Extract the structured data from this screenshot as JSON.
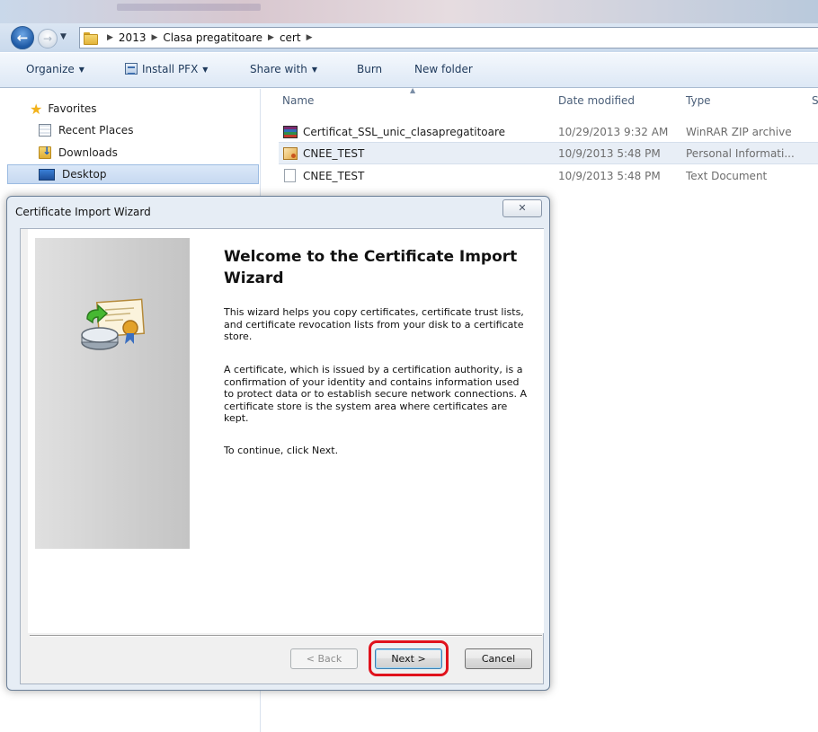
{
  "explorer": {
    "breadcrumbs": [
      "2013",
      "Clasa pregatitoare",
      "cert"
    ],
    "toolbar": {
      "organize": "Organize",
      "install_pfx": "Install PFX",
      "share_with": "Share with",
      "burn": "Burn",
      "new_folder": "New folder"
    },
    "nav": {
      "favorites": "Favorites",
      "recent_places": "Recent Places",
      "downloads": "Downloads",
      "desktop": "Desktop"
    },
    "columns": {
      "name": "Name",
      "date_modified": "Date modified",
      "type": "Type",
      "size": "S"
    },
    "files": [
      {
        "name": "Certificat_SSL_unic_clasapregatitoare",
        "date": "10/29/2013 9:32 AM",
        "type": "WinRAR ZIP archive",
        "icon": "winrar-archive-icon"
      },
      {
        "name": "CNEE_TEST",
        "date": "10/9/2013 5:48 PM",
        "type": "Personal Informati...",
        "icon": "certificate-file-icon"
      },
      {
        "name": "CNEE_TEST",
        "date": "10/9/2013 5:48 PM",
        "type": "Text Document",
        "icon": "text-document-icon"
      }
    ]
  },
  "wizard": {
    "window_title": "Certificate Import Wizard",
    "close_glyph": "✕",
    "heading": "Welcome to the Certificate Import Wizard",
    "paragraph1": "This wizard helps you copy certificates, certificate trust lists, and certificate revocation lists from your disk to a certificate store.",
    "paragraph2": "A certificate, which is issued by a certification authority, is a confirmation of your identity and contains information used to protect data or to establish secure network connections. A certificate store is the system area where certificates are kept.",
    "paragraph3": "To continue, click Next.",
    "buttons": {
      "back": "< Back",
      "next": "Next >",
      "cancel": "Cancel"
    },
    "highlight_color": "#e0121c"
  }
}
